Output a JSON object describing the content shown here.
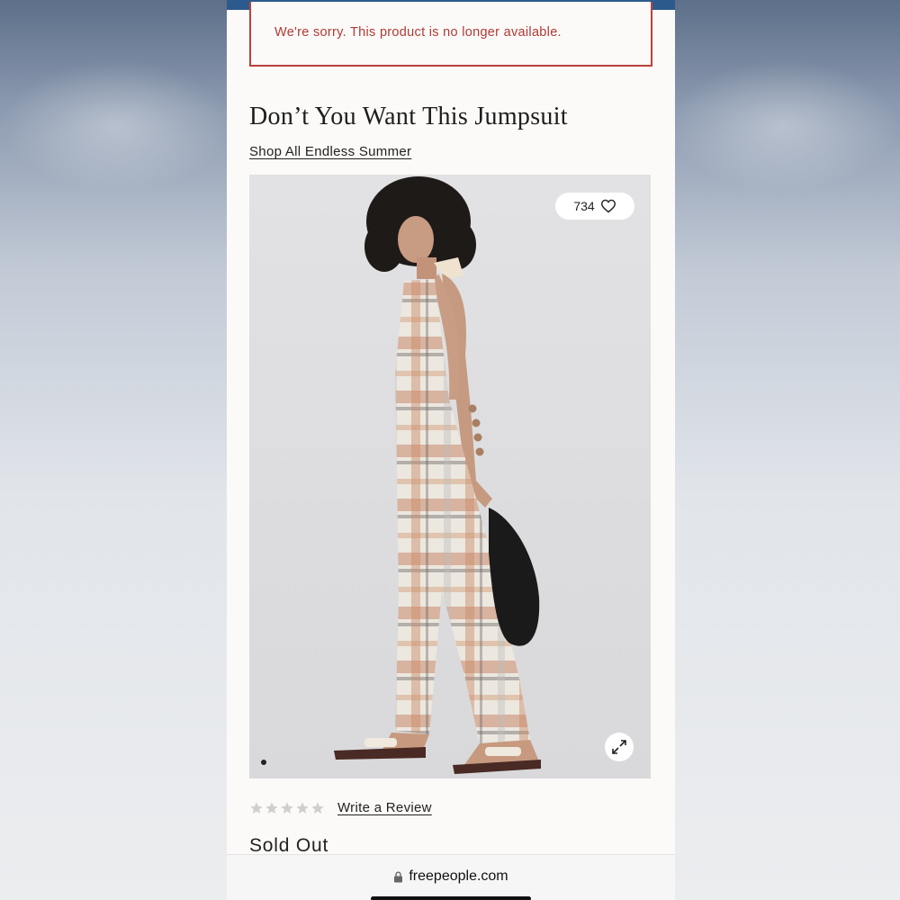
{
  "banner": {
    "message": "We're sorry. This product is no longer available."
  },
  "product": {
    "title": "Don’t You Want This Jumpsuit",
    "collection_link": "Shop All Endless Summer",
    "like_count": "734",
    "rating_stars": 0,
    "rating_max": 5,
    "review_link": "Write a Review",
    "availability": "Sold Out"
  },
  "icons": {
    "like": "heart-icon",
    "expand": "expand-icon",
    "lock": "lock-icon",
    "star": "star-icon"
  },
  "browser": {
    "url": "freepeople.com"
  },
  "colors": {
    "header_strip": "#2d5a8c",
    "alert": "#b13a35",
    "star_empty": "#cfcfcf"
  }
}
